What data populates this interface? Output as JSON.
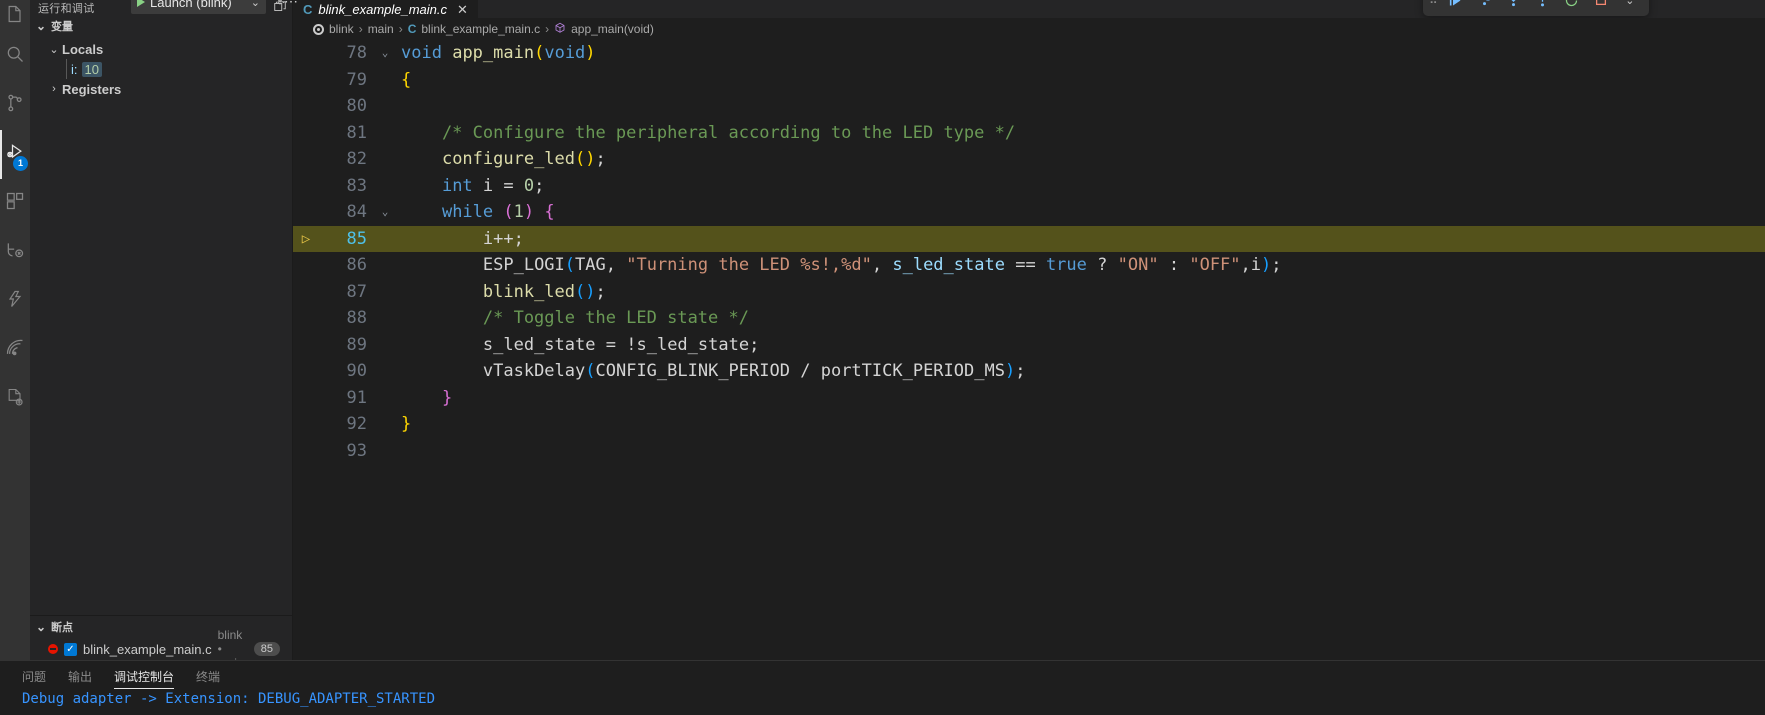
{
  "activity_bar": {
    "items": [
      {
        "name": "explorer",
        "icon": "files-icon",
        "badge": null
      },
      {
        "name": "search",
        "icon": "search-icon",
        "badge": null
      },
      {
        "name": "source-control",
        "icon": "source-control-icon",
        "badge": null
      },
      {
        "name": "run-and-debug",
        "icon": "run-debug-icon",
        "badge": "1"
      },
      {
        "name": "extensions",
        "icon": "extensions-icon",
        "badge": null
      },
      {
        "name": "testing",
        "icon": "testing-icon",
        "badge": null
      },
      {
        "name": "esp-idf",
        "icon": "esp-idf-icon",
        "badge": null
      },
      {
        "name": "wifi",
        "icon": "wifi-icon",
        "badge": null
      },
      {
        "name": "cpp-config",
        "icon": "cpp-gear-icon",
        "badge": null
      }
    ]
  },
  "sidebar": {
    "view_title": "运行和调试",
    "launch_config": "Launch (blink)",
    "run_icon": "play-icon",
    "chevron_icon": "chevron-down-icon",
    "gear_icon": "gear-icon",
    "more_icon": "ellipsis-icon",
    "variables": {
      "title": "变量",
      "twisty": "⌄",
      "actions_icon": "collapse-all-icon",
      "scopes": [
        {
          "label": "Locals",
          "expanded": true,
          "twisty": "⌄",
          "children": [
            {
              "name": "i:",
              "value": "10",
              "changed": true
            }
          ]
        },
        {
          "label": "Registers",
          "expanded": false,
          "twisty": "›",
          "children": []
        }
      ]
    },
    "breakpoints": {
      "title": "断点",
      "twisty": "⌄",
      "items": [
        {
          "file": "blink_example_main.c",
          "path": "blink • main",
          "line": "85",
          "enabled": true,
          "check_glyph": "✓",
          "dot_icon": "breakpoint-dot-icon"
        }
      ]
    }
  },
  "editor": {
    "tab": {
      "label": "blink_example_main.c",
      "file_icon": "c-file-icon",
      "close_icon": "close-icon",
      "modified": false
    },
    "split_icon": "split-editor-icon",
    "breadcrumbs": [
      {
        "label": "blink",
        "icon": "target-icon"
      },
      {
        "label": "main",
        "icon": null
      },
      {
        "label": "blink_example_main.c",
        "icon": "c-file-icon"
      },
      {
        "label": "app_main(void)",
        "icon": "symbol-method-icon"
      }
    ],
    "breadcrumb_separator": "›",
    "current_line": 85,
    "breakpoint_line": 85,
    "breakpoint_glyph": "▷",
    "lines": [
      {
        "n": "78",
        "fold": "⌄",
        "tokens": [
          {
            "t": "void",
            "c": "t-kw"
          },
          {
            "t": " ",
            "c": "t-plain"
          },
          {
            "t": "app_main",
            "c": "t-fn"
          },
          {
            "t": "(",
            "c": "t-p1"
          },
          {
            "t": "void",
            "c": "t-kw"
          },
          {
            "t": ")",
            "c": "t-p1"
          }
        ]
      },
      {
        "n": "79",
        "fold": "",
        "tokens": [
          {
            "t": "{",
            "c": "t-p1"
          }
        ]
      },
      {
        "n": "80",
        "fold": "",
        "tokens": []
      },
      {
        "n": "81",
        "fold": "",
        "tokens": [
          {
            "t": "    /* Configure the peripheral according to the LED type */",
            "c": "t-cmt"
          }
        ]
      },
      {
        "n": "82",
        "fold": "",
        "tokens": [
          {
            "t": "    ",
            "c": "t-plain"
          },
          {
            "t": "configure_led",
            "c": "t-fn"
          },
          {
            "t": "(",
            "c": "t-p1"
          },
          {
            "t": ")",
            "c": "t-p1"
          },
          {
            "t": ";",
            "c": "t-plain"
          }
        ]
      },
      {
        "n": "83",
        "fold": "",
        "tokens": [
          {
            "t": "    ",
            "c": "t-plain"
          },
          {
            "t": "int",
            "c": "t-kw"
          },
          {
            "t": " i ",
            "c": "t-plain"
          },
          {
            "t": "=",
            "c": "t-op"
          },
          {
            "t": " ",
            "c": "t-plain"
          },
          {
            "t": "0",
            "c": "t-num"
          },
          {
            "t": ";",
            "c": "t-plain"
          }
        ]
      },
      {
        "n": "84",
        "fold": "⌄",
        "tokens": [
          {
            "t": "    ",
            "c": "t-plain"
          },
          {
            "t": "while",
            "c": "t-kw"
          },
          {
            "t": " ",
            "c": "t-plain"
          },
          {
            "t": "(",
            "c": "t-p2"
          },
          {
            "t": "1",
            "c": "t-num"
          },
          {
            "t": ")",
            "c": "t-p2"
          },
          {
            "t": " ",
            "c": "t-plain"
          },
          {
            "t": "{",
            "c": "t-p2"
          }
        ]
      },
      {
        "n": "85",
        "fold": "",
        "current": true,
        "tokens": [
          {
            "t": "        i",
            "c": "t-plain"
          },
          {
            "t": "++",
            "c": "t-op"
          },
          {
            "t": ";",
            "c": "t-plain"
          }
        ]
      },
      {
        "n": "86",
        "fold": "",
        "tokens": [
          {
            "t": "        ",
            "c": "t-plain"
          },
          {
            "t": "ESP_LOGI",
            "c": "t-plain"
          },
          {
            "t": "(",
            "c": "t-p3"
          },
          {
            "t": "TAG",
            "c": "t-plain"
          },
          {
            "t": ", ",
            "c": "t-plain"
          },
          {
            "t": "\"Turning the LED %s!,%d\"",
            "c": "t-str"
          },
          {
            "t": ", ",
            "c": "t-plain"
          },
          {
            "t": "s_led_state",
            "c": "t-var"
          },
          {
            "t": " ",
            "c": "t-plain"
          },
          {
            "t": "==",
            "c": "t-op"
          },
          {
            "t": " ",
            "c": "t-plain"
          },
          {
            "t": "true",
            "c": "t-kw"
          },
          {
            "t": " ",
            "c": "t-plain"
          },
          {
            "t": "?",
            "c": "t-op"
          },
          {
            "t": " ",
            "c": "t-plain"
          },
          {
            "t": "\"ON\"",
            "c": "t-str"
          },
          {
            "t": " ",
            "c": "t-plain"
          },
          {
            "t": ":",
            "c": "t-op"
          },
          {
            "t": " ",
            "c": "t-plain"
          },
          {
            "t": "\"OFF\"",
            "c": "t-str"
          },
          {
            "t": ",i",
            "c": "t-plain"
          },
          {
            "t": ")",
            "c": "t-p3"
          },
          {
            "t": ";",
            "c": "t-plain"
          }
        ]
      },
      {
        "n": "87",
        "fold": "",
        "tokens": [
          {
            "t": "        ",
            "c": "t-plain"
          },
          {
            "t": "blink_led",
            "c": "t-fn"
          },
          {
            "t": "(",
            "c": "t-p3"
          },
          {
            "t": ")",
            "c": "t-p3"
          },
          {
            "t": ";",
            "c": "t-plain"
          }
        ]
      },
      {
        "n": "88",
        "fold": "",
        "tokens": [
          {
            "t": "        /* Toggle the LED state */",
            "c": "t-cmt"
          }
        ]
      },
      {
        "n": "89",
        "fold": "",
        "tokens": [
          {
            "t": "        ",
            "c": "t-plain"
          },
          {
            "t": "s_led_state",
            "c": "t-plain"
          },
          {
            "t": " ",
            "c": "t-plain"
          },
          {
            "t": "=",
            "c": "t-op"
          },
          {
            "t": " ",
            "c": "t-plain"
          },
          {
            "t": "!",
            "c": "t-op"
          },
          {
            "t": "s_led_state",
            "c": "t-plain"
          },
          {
            "t": ";",
            "c": "t-plain"
          }
        ]
      },
      {
        "n": "90",
        "fold": "",
        "tokens": [
          {
            "t": "        ",
            "c": "t-plain"
          },
          {
            "t": "vTaskDelay",
            "c": "t-plain"
          },
          {
            "t": "(",
            "c": "t-p3"
          },
          {
            "t": "CONFIG_BLINK_PERIOD",
            "c": "t-plain"
          },
          {
            "t": " ",
            "c": "t-plain"
          },
          {
            "t": "/",
            "c": "t-op"
          },
          {
            "t": " ",
            "c": "t-plain"
          },
          {
            "t": "portTICK_PERIOD_MS",
            "c": "t-plain"
          },
          {
            "t": ")",
            "c": "t-p3"
          },
          {
            "t": ";",
            "c": "t-plain"
          }
        ]
      },
      {
        "n": "91",
        "fold": "",
        "tokens": [
          {
            "t": "    ",
            "c": "t-plain"
          },
          {
            "t": "}",
            "c": "t-p2"
          }
        ]
      },
      {
        "n": "92",
        "fold": "",
        "tokens": [
          {
            "t": "}",
            "c": "t-p1"
          }
        ]
      },
      {
        "n": "93",
        "fold": "",
        "tokens": []
      }
    ]
  },
  "debug_toolbar": {
    "grip_icon": "drag-handle-icon",
    "buttons": [
      {
        "name": "continue-button",
        "icon": "continue-icon",
        "glyph": "▶|",
        "color": "dt-blue"
      },
      {
        "name": "step-over-button",
        "icon": "step-over-icon",
        "glyph": "⤼",
        "color": "dt-blue"
      },
      {
        "name": "step-into-button",
        "icon": "step-into-icon",
        "glyph": "⤓",
        "color": "dt-blue"
      },
      {
        "name": "step-out-button",
        "icon": "step-out-icon",
        "glyph": "⤒",
        "color": "dt-blue"
      },
      {
        "name": "restart-button",
        "icon": "restart-icon",
        "glyph": "↻",
        "color": "dt-green"
      },
      {
        "name": "stop-button",
        "icon": "stop-icon",
        "glyph": "■",
        "color": "dt-red"
      },
      {
        "name": "toolbar-dropdown",
        "icon": "chevron-down-icon",
        "glyph": "⌄",
        "color": "dt-grey"
      }
    ]
  },
  "panel": {
    "tabs": [
      {
        "label": "问题",
        "active": false
      },
      {
        "label": "输出",
        "active": false
      },
      {
        "label": "调试控制台",
        "active": true
      },
      {
        "label": "终端",
        "active": false
      }
    ],
    "console_output": "Debug adapter -> Extension: DEBUG_ADAPTER_STARTED"
  },
  "colors": {
    "accent": "#0078d4",
    "current_line_highlight": "#54521b",
    "breakpoint_red": "#e51400",
    "console_blue": "#3794ff",
    "editor_bg": "#1e1e1e",
    "sidebar_bg": "#252526",
    "activitybar_bg": "#333333"
  }
}
